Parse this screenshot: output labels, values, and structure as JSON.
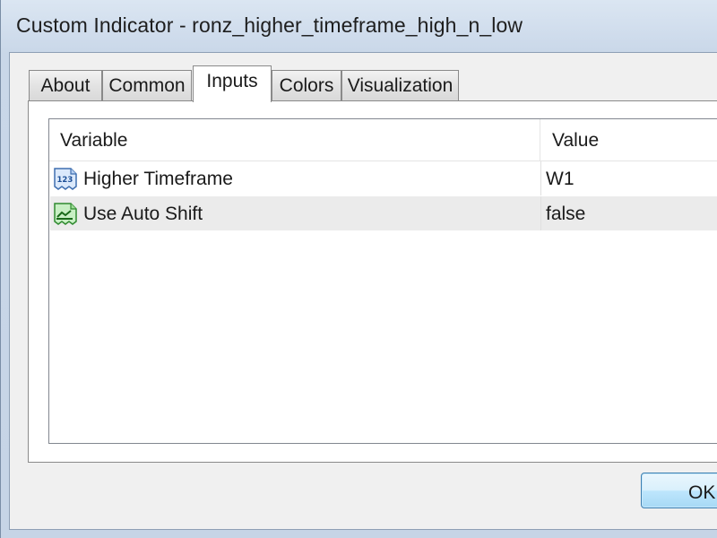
{
  "window": {
    "title": "Custom Indicator - ronz_higher_timeframe_high_n_low"
  },
  "tabs": [
    {
      "label": "About",
      "active": false
    },
    {
      "label": "Common",
      "active": false
    },
    {
      "label": "Inputs",
      "active": true
    },
    {
      "label": "Colors",
      "active": false
    },
    {
      "label": "Visualization",
      "active": false
    }
  ],
  "inputs_table": {
    "columns": [
      "Variable",
      "Value"
    ],
    "rows": [
      {
        "icon": "number-123-icon",
        "variable": "Higher Timeframe",
        "value": "W1"
      },
      {
        "icon": "boolean-toggle-icon",
        "variable": "Use Auto Shift",
        "value": "false"
      }
    ]
  },
  "buttons": {
    "ok_label": "OK"
  },
  "colors": {
    "number_icon": "#3f7fd0",
    "bool_icon": "#3fae3f",
    "selected_row": "#ebebeb"
  }
}
